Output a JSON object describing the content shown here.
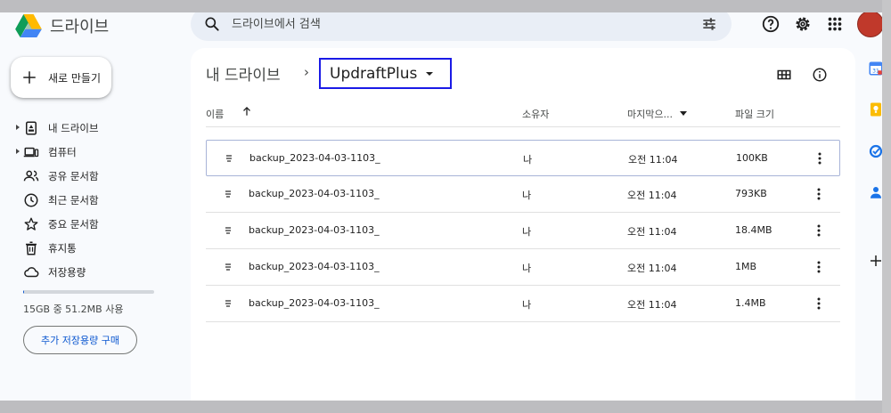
{
  "app": {
    "brand": "드라이브",
    "colors": {
      "accent": "#0b57d0",
      "folder_border": "#1a1ae6",
      "avatar": "#c0392b"
    }
  },
  "search": {
    "placeholder": "드라이브에서 검색",
    "icon": "search-icon",
    "filter_icon": "tune-icon"
  },
  "header_icons": [
    "help-icon",
    "settings-icon",
    "apps-grid-icon",
    "avatar"
  ],
  "new_button": {
    "label": "새로 만들기",
    "icon": "plus-icon"
  },
  "sidebar": {
    "items": [
      {
        "label": "내 드라이브",
        "icon": "my-drive-icon",
        "expandable": true
      },
      {
        "label": "컴퓨터",
        "icon": "computer-icon",
        "expandable": true
      },
      {
        "label": "공유 문서함",
        "icon": "shared-icon",
        "expandable": false
      },
      {
        "label": "최근 문서함",
        "icon": "clock-icon",
        "expandable": false
      },
      {
        "label": "중요 문서함",
        "icon": "star-icon",
        "expandable": false
      },
      {
        "label": "휴지통",
        "icon": "trash-icon",
        "expandable": false
      },
      {
        "label": "저장용량",
        "icon": "cloud-icon",
        "expandable": false
      }
    ],
    "storage_text": "15GB 중 51.2MB 사용",
    "storage_used_fraction": 0.0034,
    "buy_storage_label": "추가 저장용량 구매"
  },
  "breadcrumb": {
    "root": "내 드라이브",
    "separator": "›",
    "current": "UpdraftPlus"
  },
  "view_icons": [
    "grid-view-icon",
    "info-icon"
  ],
  "table": {
    "headers": {
      "name": "이름",
      "owner": "소유자",
      "modified": "마지막으...",
      "size": "파일 크기"
    },
    "sort": {
      "column": "name",
      "direction": "ascending"
    },
    "rows": [
      {
        "name": "backup_2023-04-03-1103_",
        "owner": "나",
        "modified": "오전 11:04",
        "size": "100KB",
        "selected": true
      },
      {
        "name": "backup_2023-04-03-1103_",
        "owner": "나",
        "modified": "오전 11:04",
        "size": "793KB",
        "selected": false
      },
      {
        "name": "backup_2023-04-03-1103_",
        "owner": "나",
        "modified": "오전 11:04",
        "size": "18.4MB",
        "selected": false
      },
      {
        "name": "backup_2023-04-03-1103_",
        "owner": "나",
        "modified": "오전 11:04",
        "size": "1MB",
        "selected": false
      },
      {
        "name": "backup_2023-04-03-1103_",
        "owner": "나",
        "modified": "오전 11:04",
        "size": "1.4MB",
        "selected": false
      }
    ]
  },
  "right_rail": [
    "calendar-icon",
    "keep-icon",
    "tasks-icon",
    "contacts-icon",
    "add-addon-icon"
  ]
}
